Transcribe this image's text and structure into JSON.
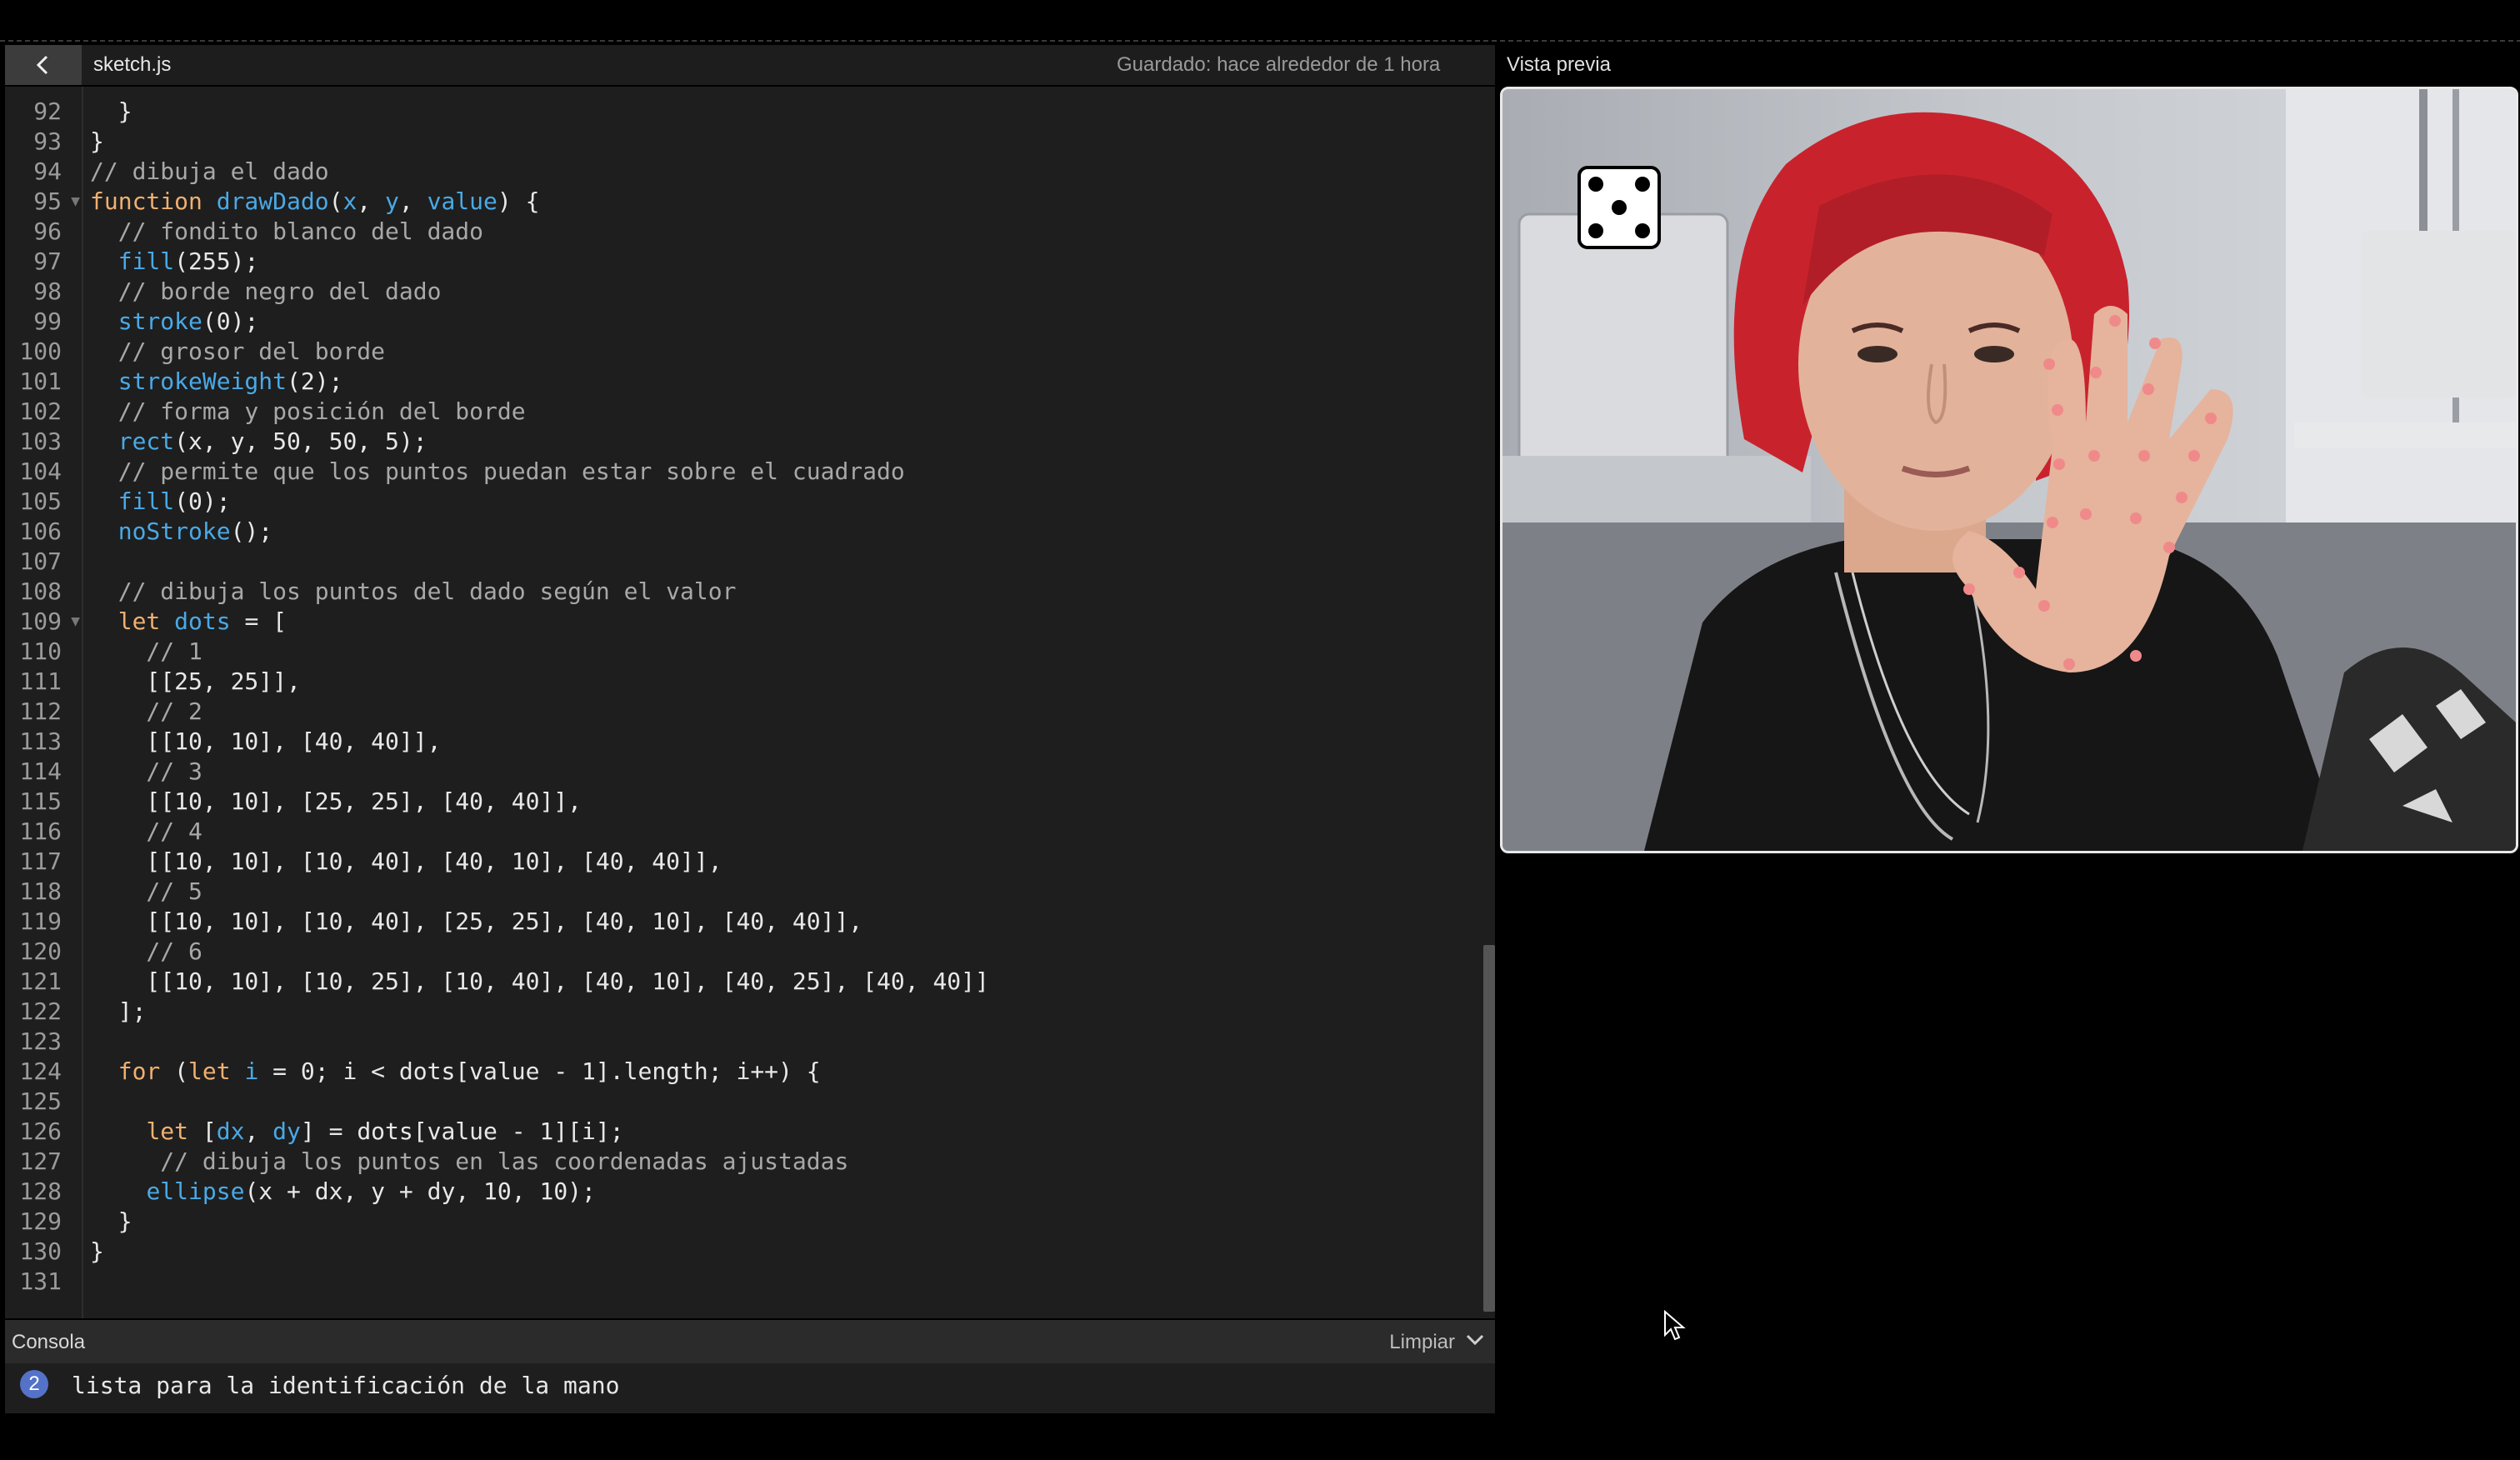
{
  "header": {
    "file_name": "sketch.js",
    "saved_status": "Guardado: hace alrededor de 1 hora",
    "preview_label": "Vista previa"
  },
  "editor": {
    "lines": [
      {
        "n": "92",
        "fold": false,
        "tokens": [
          {
            "t": "  }",
            "c": ""
          }
        ]
      },
      {
        "n": "93",
        "fold": false,
        "tokens": [
          {
            "t": "}",
            "c": ""
          }
        ]
      },
      {
        "n": "94",
        "fold": false,
        "tokens": [
          {
            "t": "// dibuja el dado",
            "c": "c"
          }
        ]
      },
      {
        "n": "95",
        "fold": true,
        "tokens": [
          {
            "t": "function ",
            "c": "k"
          },
          {
            "t": "drawDado",
            "c": "f"
          },
          {
            "t": "(",
            "c": ""
          },
          {
            "t": "x",
            "c": "v"
          },
          {
            "t": ", ",
            "c": ""
          },
          {
            "t": "y",
            "c": "v"
          },
          {
            "t": ", ",
            "c": ""
          },
          {
            "t": "value",
            "c": "v"
          },
          {
            "t": ") {",
            "c": ""
          }
        ]
      },
      {
        "n": "96",
        "fold": false,
        "tokens": [
          {
            "t": "  // fondito blanco del dado",
            "c": "c"
          }
        ]
      },
      {
        "n": "97",
        "fold": false,
        "tokens": [
          {
            "t": "  ",
            "c": ""
          },
          {
            "t": "fill",
            "c": "f"
          },
          {
            "t": "(255);",
            "c": ""
          }
        ]
      },
      {
        "n": "98",
        "fold": false,
        "tokens": [
          {
            "t": "  // borde negro del dado",
            "c": "c"
          }
        ]
      },
      {
        "n": "99",
        "fold": false,
        "tokens": [
          {
            "t": "  ",
            "c": ""
          },
          {
            "t": "stroke",
            "c": "f"
          },
          {
            "t": "(0);",
            "c": ""
          }
        ]
      },
      {
        "n": "100",
        "fold": false,
        "tokens": [
          {
            "t": "  // grosor del borde",
            "c": "c"
          }
        ]
      },
      {
        "n": "101",
        "fold": false,
        "tokens": [
          {
            "t": "  ",
            "c": ""
          },
          {
            "t": "strokeWeight",
            "c": "f"
          },
          {
            "t": "(2);",
            "c": ""
          }
        ]
      },
      {
        "n": "102",
        "fold": false,
        "tokens": [
          {
            "t": "  // forma y posición del borde",
            "c": "c"
          }
        ]
      },
      {
        "n": "103",
        "fold": false,
        "tokens": [
          {
            "t": "  ",
            "c": ""
          },
          {
            "t": "rect",
            "c": "f"
          },
          {
            "t": "(x, y, 50, 50, 5);",
            "c": ""
          }
        ]
      },
      {
        "n": "104",
        "fold": false,
        "tokens": [
          {
            "t": "  // permite que los puntos puedan estar sobre el cuadrado",
            "c": "c"
          }
        ]
      },
      {
        "n": "105",
        "fold": false,
        "tokens": [
          {
            "t": "  ",
            "c": ""
          },
          {
            "t": "fill",
            "c": "f"
          },
          {
            "t": "(0);",
            "c": ""
          }
        ]
      },
      {
        "n": "106",
        "fold": false,
        "tokens": [
          {
            "t": "  ",
            "c": ""
          },
          {
            "t": "noStroke",
            "c": "f"
          },
          {
            "t": "();",
            "c": ""
          }
        ]
      },
      {
        "n": "107",
        "fold": false,
        "tokens": []
      },
      {
        "n": "108",
        "fold": false,
        "tokens": [
          {
            "t": "  // dibuja los puntos del dado según el valor",
            "c": "c"
          }
        ]
      },
      {
        "n": "109",
        "fold": true,
        "tokens": [
          {
            "t": "  ",
            "c": ""
          },
          {
            "t": "let ",
            "c": "k"
          },
          {
            "t": "dots",
            "c": "v"
          },
          {
            "t": " = [",
            "c": ""
          }
        ]
      },
      {
        "n": "110",
        "fold": false,
        "tokens": [
          {
            "t": "    // 1",
            "c": "c"
          }
        ]
      },
      {
        "n": "111",
        "fold": false,
        "tokens": [
          {
            "t": "    [[25, 25]],",
            "c": ""
          }
        ]
      },
      {
        "n": "112",
        "fold": false,
        "tokens": [
          {
            "t": "    // 2",
            "c": "c"
          }
        ]
      },
      {
        "n": "113",
        "fold": false,
        "tokens": [
          {
            "t": "    [[10, 10], [40, 40]],",
            "c": ""
          }
        ]
      },
      {
        "n": "114",
        "fold": false,
        "tokens": [
          {
            "t": "    // 3",
            "c": "c"
          }
        ]
      },
      {
        "n": "115",
        "fold": false,
        "tokens": [
          {
            "t": "    [[10, 10], [25, 25], [40, 40]],",
            "c": ""
          }
        ]
      },
      {
        "n": "116",
        "fold": false,
        "tokens": [
          {
            "t": "    // 4",
            "c": "c"
          }
        ]
      },
      {
        "n": "117",
        "fold": false,
        "tokens": [
          {
            "t": "    [[10, 10], [10, 40], [40, 10], [40, 40]],",
            "c": ""
          }
        ]
      },
      {
        "n": "118",
        "fold": false,
        "tokens": [
          {
            "t": "    // 5",
            "c": "c"
          }
        ]
      },
      {
        "n": "119",
        "fold": false,
        "tokens": [
          {
            "t": "    [[10, 10], [10, 40], [25, 25], [40, 10], [40, 40]],",
            "c": ""
          }
        ]
      },
      {
        "n": "120",
        "fold": false,
        "tokens": [
          {
            "t": "    // 6",
            "c": "c"
          }
        ]
      },
      {
        "n": "121",
        "fold": false,
        "tokens": [
          {
            "t": "    [[10, 10], [10, 25], [10, 40], [40, 10], [40, 25], [40, 40]]",
            "c": ""
          }
        ]
      },
      {
        "n": "122",
        "fold": false,
        "tokens": [
          {
            "t": "  ];",
            "c": ""
          }
        ]
      },
      {
        "n": "123",
        "fold": false,
        "tokens": []
      },
      {
        "n": "124",
        "fold": false,
        "tokens": [
          {
            "t": "  ",
            "c": ""
          },
          {
            "t": "for",
            "c": "k"
          },
          {
            "t": " (",
            "c": ""
          },
          {
            "t": "let ",
            "c": "k"
          },
          {
            "t": "i",
            "c": "v"
          },
          {
            "t": " = 0; i < dots[value - 1].length; i++) {",
            "c": ""
          }
        ]
      },
      {
        "n": "125",
        "fold": false,
        "tokens": []
      },
      {
        "n": "126",
        "fold": false,
        "tokens": [
          {
            "t": "    ",
            "c": ""
          },
          {
            "t": "let ",
            "c": "k"
          },
          {
            "t": "[",
            "c": ""
          },
          {
            "t": "dx",
            "c": "v"
          },
          {
            "t": ", ",
            "c": ""
          },
          {
            "t": "dy",
            "c": "v"
          },
          {
            "t": "] = dots[value - 1][i];",
            "c": ""
          }
        ]
      },
      {
        "n": "127",
        "fold": false,
        "tokens": [
          {
            "t": "     // dibuja los puntos en las coordenadas ajustadas",
            "c": "c"
          }
        ]
      },
      {
        "n": "128",
        "fold": false,
        "tokens": [
          {
            "t": "    ",
            "c": ""
          },
          {
            "t": "ellipse",
            "c": "f"
          },
          {
            "t": "(x + dx, y + dy, 10, 10);",
            "c": ""
          }
        ]
      },
      {
        "n": "129",
        "fold": false,
        "tokens": [
          {
            "t": "  }",
            "c": ""
          }
        ]
      },
      {
        "n": "130",
        "fold": false,
        "tokens": [
          {
            "t": "}",
            "c": ""
          }
        ]
      },
      {
        "n": "131",
        "fold": false,
        "tokens": []
      }
    ]
  },
  "console": {
    "title": "Consola",
    "clear_label": "Limpiar",
    "badge_count": "2",
    "message": "lista para la identificación de la mano"
  },
  "preview": {
    "die_value": 5,
    "colors": {
      "hair": "#c8232d",
      "jacket": "#161616",
      "landmark": "#f08a8a",
      "wall": "#b7bcc2"
    }
  },
  "icons": [
    "chevron-left-icon",
    "chevron-down-icon",
    "fold-arrow-icon",
    "mouse-cursor-icon"
  ]
}
